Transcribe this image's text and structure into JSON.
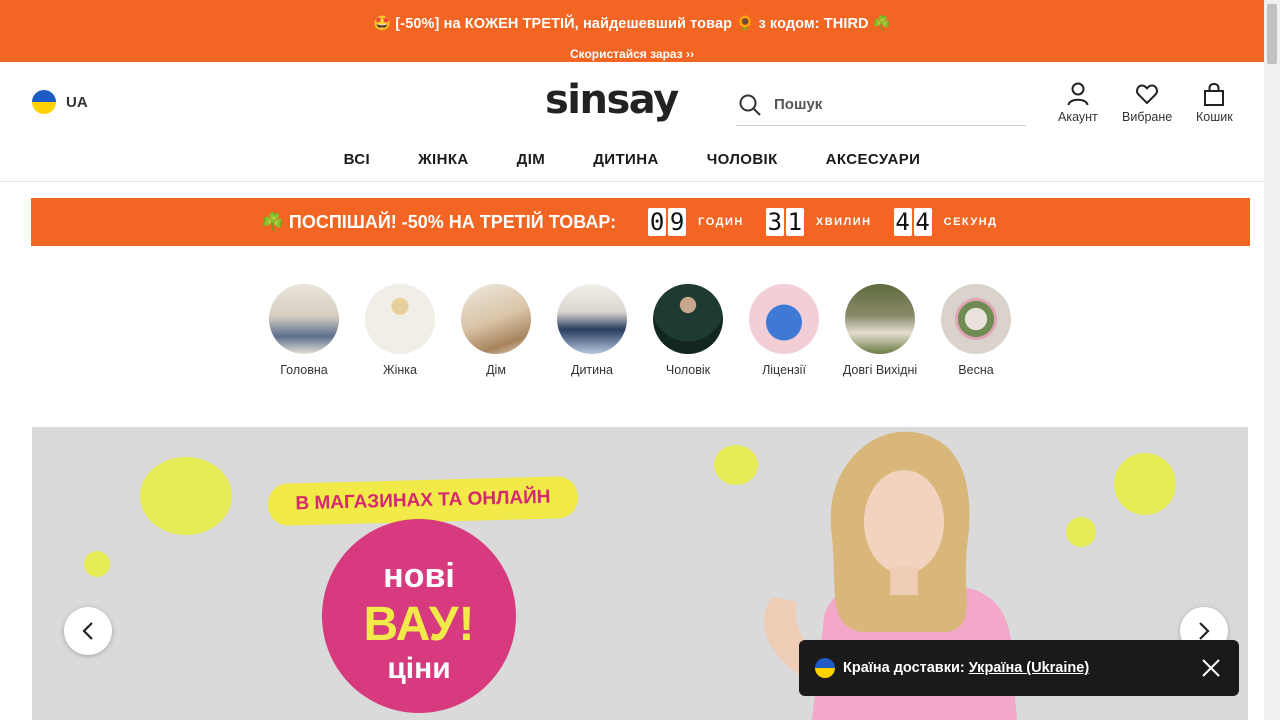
{
  "promo": {
    "main_text": "🤩 [-50%] на КОЖЕН ТРЕТІЙ, найдешевший товар 🌻 з кодом: THIRD ☘️",
    "link_text": "Скористайся зараз ››",
    "bg_color": "#f26522"
  },
  "header": {
    "country_code": "UA",
    "logo": "sinsay",
    "search_placeholder": "Пошук",
    "account_label": "Акаунт",
    "favorites_label": "Вибране",
    "cart_label": "Кошик"
  },
  "nav": {
    "items": [
      "ВСІ",
      "ЖІНКА",
      "ДІМ",
      "ДИТИНА",
      "ЧОЛОВІК",
      "АКСЕСУАРИ"
    ]
  },
  "countdown": {
    "text": "☘️ ПОСПІШАЙ! -50% НА ТРЕТІЙ ТОВАР:",
    "hours": [
      "0",
      "9"
    ],
    "hours_label": "ГОДИН",
    "minutes": [
      "3",
      "1"
    ],
    "minutes_label": "ХВИЛИН",
    "seconds": [
      "4",
      "4"
    ],
    "seconds_label": "СЕКУНД"
  },
  "categories": [
    {
      "label": "Головна",
      "icon": "family-photo"
    },
    {
      "label": "Жінка",
      "icon": "woman-photo"
    },
    {
      "label": "Дім",
      "icon": "home-photo"
    },
    {
      "label": "Дитина",
      "icon": "kids-photo"
    },
    {
      "label": "Чоловік",
      "icon": "man-photo"
    },
    {
      "label": "Ліцензії",
      "icon": "stitch-plush-photo"
    },
    {
      "label": "Довгі Вихідні",
      "icon": "hammock-photo"
    },
    {
      "label": "Весна",
      "icon": "wreath-photo"
    }
  ],
  "banner": {
    "tag": "В МАГАЗИНАХ ТА ОНЛАЙН",
    "line1": "нові",
    "line2": "ВАУ!",
    "line3": "ціни"
  },
  "toast": {
    "label": "Країна доставки:",
    "country": "Україна (Ukraine)"
  }
}
